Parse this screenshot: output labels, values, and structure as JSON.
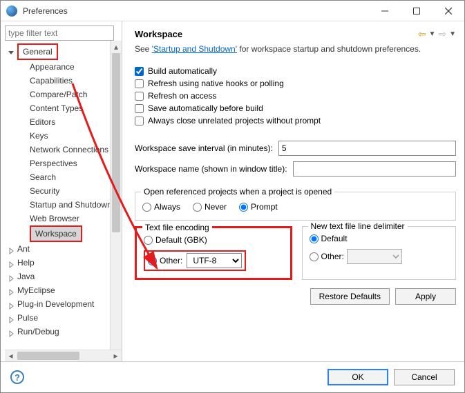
{
  "window": {
    "title": "Preferences"
  },
  "sidebar": {
    "filter_placeholder": "type filter text",
    "items": [
      {
        "label": "General",
        "expanded": true,
        "highlight": true,
        "children": [
          {
            "label": "Appearance"
          },
          {
            "label": "Capabilities"
          },
          {
            "label": "Compare/Patch"
          },
          {
            "label": "Content Types"
          },
          {
            "label": "Editors"
          },
          {
            "label": "Keys"
          },
          {
            "label": "Network Connections"
          },
          {
            "label": "Perspectives"
          },
          {
            "label": "Search"
          },
          {
            "label": "Security"
          },
          {
            "label": "Startup and Shutdown"
          },
          {
            "label": "Web Browser"
          },
          {
            "label": "Workspace",
            "highlight": true,
            "selected": true
          }
        ]
      },
      {
        "label": "Ant"
      },
      {
        "label": "Help"
      },
      {
        "label": "Java"
      },
      {
        "label": "MyEclipse"
      },
      {
        "label": "Plug-in Development"
      },
      {
        "label": "Pulse"
      },
      {
        "label": "Run/Debug"
      }
    ]
  },
  "main": {
    "heading": "Workspace",
    "desc_prefix": "See ",
    "desc_link": "'Startup and Shutdown'",
    "desc_suffix": " for workspace startup and shutdown preferences.",
    "checks": [
      {
        "label": "Build automatically",
        "checked": true
      },
      {
        "label": "Refresh using native hooks or polling",
        "checked": false
      },
      {
        "label": "Refresh on access",
        "checked": false
      },
      {
        "label": "Save automatically before build",
        "checked": false
      },
      {
        "label": "Always close unrelated projects without prompt",
        "checked": false
      }
    ],
    "save_interval_label": "Workspace save interval (in minutes):",
    "save_interval_value": "5",
    "workspace_name_label": "Workspace name (shown in window title):",
    "workspace_name_value": "",
    "open_ref_title": "Open referenced projects when a project is opened",
    "open_ref_options": [
      {
        "label": "Always",
        "checked": false
      },
      {
        "label": "Never",
        "checked": false
      },
      {
        "label": "Prompt",
        "checked": true
      }
    ],
    "encoding": {
      "title": "Text file encoding",
      "default_label": "Default (GBK)",
      "other_label": "Other:",
      "other_value": "UTF-8",
      "selected": "other"
    },
    "delimiter": {
      "title": "New text file line delimiter",
      "default_label": "Default",
      "other_label": "Other:",
      "other_value": "",
      "selected": "default"
    },
    "restore_label": "Restore Defaults",
    "apply_label": "Apply"
  },
  "footer": {
    "ok_label": "OK",
    "cancel_label": "Cancel"
  }
}
